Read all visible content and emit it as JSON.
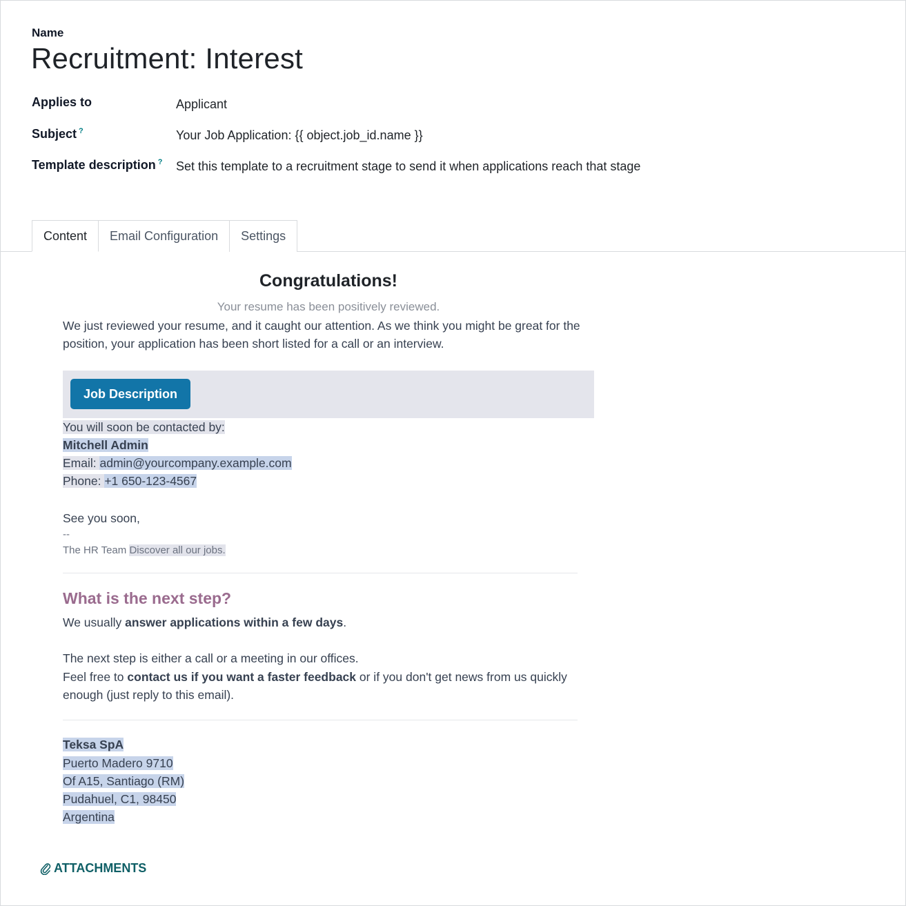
{
  "form": {
    "name_label": "Name",
    "title": "Recruitment: Interest",
    "applies_to_label": "Applies to",
    "applies_to_value": "Applicant",
    "subject_label": "Subject",
    "subject_value": "Your Job Application: {{ object.job_id.name }}",
    "template_description_label": "Template description",
    "template_description_value": "Set this template to a recruitment stage to send it when applications reach that stage",
    "help_mark": "?"
  },
  "tabs": [
    {
      "label": "Content"
    },
    {
      "label": "Email Configuration"
    },
    {
      "label": "Settings"
    }
  ],
  "email": {
    "heading": "Congratulations!",
    "subheading": "Your resume has been positively reviewed.",
    "intro_line1": "We just reviewed your resume, and it caught our attention. As we think you might be great for the",
    "intro_line2": "position, your application has been short listed for a call or an interview.",
    "button_label": "Job Description",
    "contact_intro": "You will soon be contacted by:",
    "contact_name": "Mitchell Admin",
    "email_prefix": "Email: ",
    "email_value": "admin@yourcompany.example.com",
    "phone_prefix": "Phone: ",
    "phone_value": "+1 650-123-4567",
    "see_you": "See you soon,",
    "signature_sep": "--",
    "team": "The HR Team ",
    "discover": "Discover all our jobs.",
    "next_step_title": "What is the next step?",
    "answer_prefix": "We usually ",
    "answer_bold": "answer applications within a few days",
    "answer_suffix": ".",
    "next_step_line": "The next step is either a call or a meeting in our offices.",
    "feel_free_prefix": "Feel free to ",
    "feel_free_bold": "contact us if you want a faster feedback",
    "feel_free_suffix": " or if you don't get news from us quickly",
    "feel_free_line2": "enough (just reply to this email).",
    "company_name": "Teksa SpA",
    "address1": "Puerto Madero 9710",
    "address2": "Of A15, Santiago (RM)",
    "address3": "Pudahuel, C1, 98450",
    "address4": "Argentina"
  },
  "attachments_label": "ATTACHMENTS",
  "icons": {
    "attachments": "paperclip-icon"
  },
  "colors": {
    "button": "#1275a8",
    "next_step_title": "#9a6b8e",
    "attachments": "#0f5f66",
    "help_mark": "#017e84"
  }
}
